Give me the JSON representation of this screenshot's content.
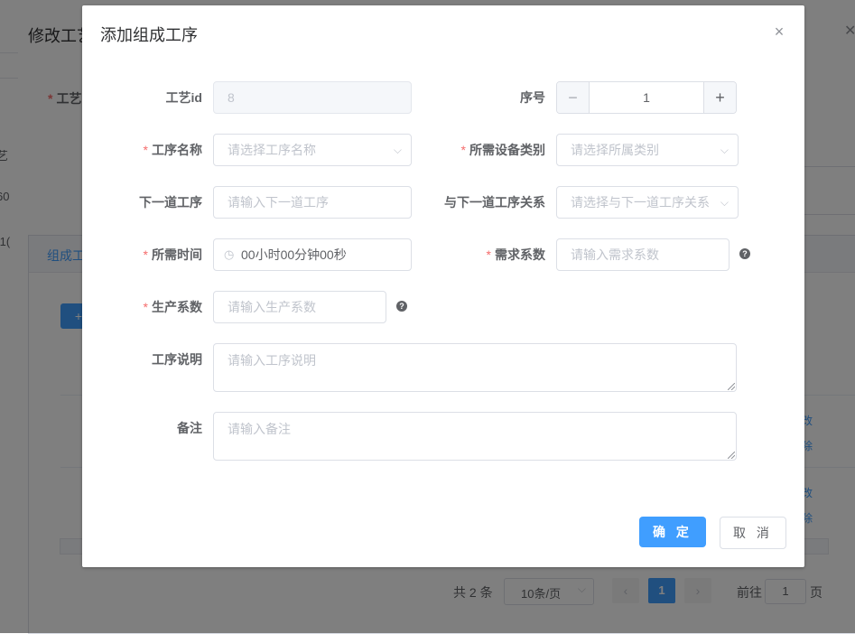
{
  "background": {
    "title": "修改工艺",
    "required_label": "工艺",
    "fragment_1": "艺",
    "fragment_2": "60",
    "fragment_3": ":1(",
    "tab_label": "组成工",
    "add_button": "+",
    "row_link_edit": "改",
    "row_link_delete": "除",
    "pagination": {
      "total": "共 2 条",
      "page_size": "10条/页",
      "current_page": "1",
      "goto_label": "前往",
      "goto_value": "1",
      "page_suffix": "页"
    }
  },
  "dialog": {
    "title": "添加组成工序",
    "fields": {
      "process_id": {
        "label": "工艺id",
        "value": "8"
      },
      "seq": {
        "label": "序号",
        "value": "1"
      },
      "step_name": {
        "label": "工序名称",
        "placeholder": "请选择工序名称"
      },
      "equipment": {
        "label": "所需设备类别",
        "placeholder": "请选择所属类别"
      },
      "next_step": {
        "label": "下一道工序",
        "placeholder": "请输入下一道工序"
      },
      "next_relation": {
        "label": "与下一道工序关系",
        "placeholder": "请选择与下一道工序关系"
      },
      "time_needed": {
        "label": "所需时间",
        "value": "00小时00分钟00秒"
      },
      "demand_factor": {
        "label": "需求系数",
        "placeholder": "请输入需求系数"
      },
      "production_factor": {
        "label": "生产系数",
        "placeholder": "请输入生产系数"
      },
      "description": {
        "label": "工序说明",
        "placeholder": "请输入工序说明"
      },
      "remark": {
        "label": "备注",
        "placeholder": "请输入备注"
      }
    },
    "confirm_label": "确 定",
    "cancel_label": "取 消"
  },
  "colors": {
    "primary": "#409eff",
    "required": "#f56c6c",
    "mask": "rgba(0,0,0,0.5)"
  }
}
